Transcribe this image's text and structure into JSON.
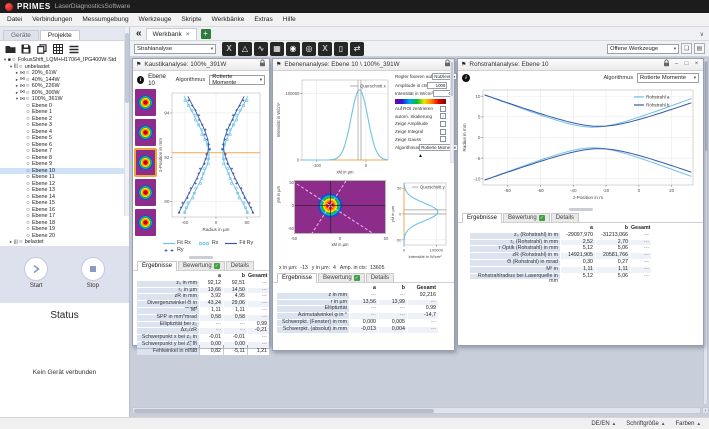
{
  "window": {
    "brand": "PRIMES",
    "app": "LaserDiagnosticsSoftware"
  },
  "menu": {
    "items": [
      "Datei",
      "Verbindungen",
      "Messumgebung",
      "Werkzeuge",
      "Skripte",
      "Werkbänke",
      "Extras",
      "Hilfe"
    ]
  },
  "sidebar": {
    "tabs": [
      "Geräte",
      "Projekte"
    ],
    "active_tab": "Projekte",
    "tree": {
      "root": "FokusShift_LQM+H17064_IPG400W-Std",
      "group": "unbelastet",
      "series": [
        {
          "label": "20%_61W",
          "expanded": false
        },
        {
          "label": "40%_144W",
          "expanded": false
        },
        {
          "label": "60%_226W",
          "expanded": false
        },
        {
          "label": "80%_300W",
          "expanded": false
        },
        {
          "label": "100%_361W",
          "expanded": true
        }
      ],
      "planes": [
        "Ebene 0",
        "Ebene 1",
        "Ebene 2",
        "Ebene 3",
        "Ebene 4",
        "Ebene 5",
        "Ebene 6",
        "Ebene 7",
        "Ebene 8",
        "Ebene 9",
        "Ebene 10",
        "Ebene 11",
        "Ebene 12",
        "Ebene 13",
        "Ebene 14",
        "Ebene 15",
        "Ebene 16",
        "Ebene 17",
        "Ebene 18",
        "Ebene 19",
        "Ebene 20"
      ],
      "selected": "Ebene 10",
      "tail": "belastet"
    },
    "start_label": "Start",
    "stop_label": "Stop",
    "status_title": "Status",
    "status_message": "Kein Gerät verbunden"
  },
  "workspace": {
    "tab_label": "Werkbank",
    "open_tools_label": "Offene Werkzeuge",
    "analysis_select": "Strahlanalyse"
  },
  "result_tabs": [
    "Ergebnisse",
    "Bewertung",
    "Details"
  ],
  "kaustik": {
    "title": "Kaustikanalyse: 100%_391W",
    "level_label": "Ebene 10",
    "algorithm_label": "Algorithmus",
    "algorithm_value": "Rotierte Momente",
    "selected_thumb_index": 2,
    "legend": [
      {
        "label": "Fit Rx",
        "glyph": "line",
        "color": "#6fc2e8"
      },
      {
        "label": "Rx",
        "glyph": "circles",
        "color": "#6fc2e8"
      },
      {
        "label": "Fit Ry",
        "glyph": "line",
        "color": "#3b57a8"
      },
      {
        "label": "Ry",
        "glyph": "plus",
        "color": "#3b57a8"
      }
    ],
    "table": {
      "widths": [
        62,
        23,
        23,
        21
      ],
      "header": [
        "a",
        "b",
        "Gesamt"
      ],
      "rows": [
        [
          "z₀ in mm",
          "92,12",
          "92,51",
          "---"
        ],
        [
          "r₀ in µm",
          "13,66",
          "14,50",
          "---"
        ],
        [
          "zR in mm",
          "3,92",
          "4,95",
          "---"
        ],
        [
          "Divergenzwinkel Θ in mrad",
          "43,24",
          "29,06",
          "---"
        ],
        [
          "M²",
          "1,11",
          "1,11",
          "---"
        ],
        [
          "SPP in mm*mrad",
          "0,58",
          "0,58",
          "---"
        ],
        [
          "Elliptizität bei z₀",
          "---",
          "---",
          "0,99"
        ],
        [
          "Δz₀/zR",
          "---",
          "---",
          "-0,21"
        ],
        [
          "Schwerpunkt x bei z₀ in mm",
          "-0,01",
          "-0,01",
          "---"
        ],
        [
          "Schwerpunkt y bei z₀ in mm",
          "0,00",
          "0,00",
          "---"
        ],
        [
          "Fehlwinkel in mrad",
          "0,82",
          "-5,11",
          "1,21"
        ]
      ]
    }
  },
  "ebenen": {
    "title": "Ebenenanalyse: Ebene 10 \\ 100%_391W",
    "controls": [
      {
        "name": "regler-fixieren-select",
        "label": "Regler fixieren auf",
        "type": "select",
        "value": "Nutzlevel"
      },
      {
        "name": "amplitude-input",
        "label": "Amplitude in cts",
        "type": "input",
        "value": "1005"
      },
      {
        "name": "intensitaet-input",
        "label": "Intensität in W/cm²",
        "type": "input",
        "value": "0"
      },
      {
        "name": "colorscale",
        "label": "",
        "type": "gradient"
      },
      {
        "name": "roi-zentrieren-checkbox",
        "label": "Auf ROI zentrieren",
        "type": "check",
        "checked": false
      },
      {
        "name": "autom-skalierung-checkbox",
        "label": "autom. Skalierung",
        "type": "check",
        "checked": true
      },
      {
        "name": "zeige-amplitude-checkbox",
        "label": "Zeige Amplitude",
        "type": "check",
        "checked": false
      },
      {
        "name": "zeige-integral-checkbox",
        "label": "Zeige Integral",
        "type": "check",
        "checked": false
      },
      {
        "name": "zeige-gauss-checkbox",
        "label": "Zeige Gauss",
        "type": "check",
        "checked": false
      },
      {
        "name": "algorithmus-select",
        "label": "Algorithmus",
        "type": "select",
        "value": "Rotierte Momente"
      }
    ],
    "cursor": {
      "x_label": "x in µm:",
      "x": "-13",
      "y_label": "y in µm:",
      "y": "4",
      "amp_label": "Amp. in cts:",
      "amp": "13605"
    },
    "map": {
      "xlabel": "xM in µm",
      "ylabel": "yM in µm",
      "xticks": [
        "-50",
        "0",
        "50"
      ],
      "yticks": [
        "50",
        "0",
        "-50"
      ]
    },
    "table": {
      "widths": [
        72,
        28,
        28,
        30
      ],
      "header": [
        "a",
        "b",
        "Gesamt"
      ],
      "rows": [
        [
          "z in mm",
          "---",
          "---",
          "92,216"
        ],
        [
          "r in µm",
          "13,56",
          "13,99",
          "---"
        ],
        [
          "Elliptizität",
          "---",
          "---",
          "0,99"
        ],
        [
          "Azimutalwinkel φ in °",
          "---",
          "---",
          "-14,7"
        ],
        [
          "Schwerpkt. (Fenster) in mm",
          "0,000",
          "0,005",
          "---"
        ],
        [
          "Schwerpkt. (absolut) in mm",
          "-0,013",
          "0,004",
          "---"
        ]
      ]
    }
  },
  "rohstrahl": {
    "title": "Rohstrahlanalyse: Ebene 10",
    "algorithm_label": "Algorithmus",
    "algorithm_value": "Rotierte Momente",
    "table": {
      "widths": [
        90,
        34,
        34,
        20
      ],
      "header": [
        "a",
        "b",
        "Gesamt"
      ],
      "rows": [
        [
          "z₀ (Rohstrahl) in m",
          "-29097,970",
          "-31213,066",
          "---"
        ],
        [
          "r₀ (Rohstrahl) in mm",
          "2,52",
          "2,70",
          "---"
        ],
        [
          "r Optik (Rohstrahl) in mm",
          "5,12",
          "5,06",
          "---"
        ],
        [
          "zR (Rohstrahl) in m",
          "14921,905",
          "20581,766",
          "---"
        ],
        [
          "Θ (Rohstrahl) in mrad",
          "0,30",
          "0,27",
          "---"
        ],
        [
          "M² in",
          "1,11",
          "1,11",
          "---"
        ],
        [
          "Rohstrahlradius bei Laserquelle in mm",
          "5,12",
          "5,06",
          "---"
        ]
      ]
    }
  },
  "statusbar": {
    "items": [
      "DE/EN",
      "Schriftgröße",
      "Farben"
    ]
  },
  "colors": {
    "accent_orange": "#f0a84c",
    "light_blue": "#6fc2e8",
    "dark_blue": "#3b57a8",
    "purple": "#8e2c8c",
    "green_check": "#3fa143"
  },
  "chart_data": [
    {
      "id": "caustic",
      "type": "scatter",
      "panel": "Kaustikanalyse",
      "xlabel": "Radius in µm",
      "ylabel": "z-Position in mm",
      "xlim": [
        -85,
        85
      ],
      "ylim": [
        89.3,
        94.9
      ],
      "xticks": [
        -60,
        0,
        60
      ],
      "yticks": [
        90,
        92,
        94
      ],
      "focus_line_z": 92.2,
      "series": [
        {
          "name": "Fit Rx",
          "style": "line",
          "color": "#6fc2e8",
          "fit": {
            "r0_um": 13.66,
            "z0_mm": 92.12,
            "zr_mm": 0.6
          }
        },
        {
          "name": "Rx",
          "style": "circles",
          "color": "#6fc2e8",
          "fit": {
            "r0_um": 13.66,
            "z0_mm": 92.12,
            "zr_mm": 0.6
          }
        },
        {
          "name": "Fit Ry",
          "style": "line",
          "color": "#3b57a8",
          "fit": {
            "r0_um": 14.5,
            "z0_mm": 92.51,
            "zr_mm": 0.62
          }
        },
        {
          "name": "Ry",
          "style": "plus",
          "color": "#3b57a8",
          "fit": {
            "r0_um": 14.5,
            "z0_mm": 92.51,
            "zr_mm": 0.62
          }
        }
      ]
    },
    {
      "id": "qx",
      "type": "line",
      "panel": "Ebenenanalyse",
      "label": "Querschnitt x",
      "xlabel": "xM in µm",
      "ylabel": "Intensität in W/cm²",
      "xlim": [
        -130,
        45
      ],
      "ylim": [
        0,
        120000
      ],
      "xticks": [
        -100,
        0
      ],
      "yticks": [
        0,
        100000
      ],
      "gauss": {
        "center": -13,
        "sigma": 17,
        "amp": 105000
      },
      "color": "#6fc2e8"
    },
    {
      "id": "qy",
      "type": "line",
      "panel": "Ebenenanalyse",
      "label": "Querschnitt y",
      "xlabel": "Intensität in W/cm²",
      "ylabel": "yM in µm",
      "xlim": [
        0,
        130000
      ],
      "ylim": [
        -60,
        60
      ],
      "xticks": [
        0,
        100000
      ],
      "yticks": [
        50,
        0,
        -50
      ],
      "gauss": {
        "center": 4,
        "sigma": 17,
        "amp": 105000
      },
      "color": "#6fc2e8"
    },
    {
      "id": "beammap",
      "type": "heatmap",
      "panel": "Ebenenanalyse",
      "xlabel": "xM in µm",
      "ylabel": "yM in µm",
      "xlim": [
        -60,
        60
      ],
      "ylim": [
        -60,
        60
      ],
      "xticks": [
        -50,
        0,
        50
      ],
      "yticks": [
        50,
        0,
        -50
      ],
      "spot_center_um": [
        -13,
        4
      ]
    },
    {
      "id": "raw",
      "type": "line",
      "panel": "Rohstrahlanalyse",
      "xlabel": "z-Position in m",
      "ylabel": "Radius in mm",
      "xlim": [
        -95,
        33
      ],
      "ylim": [
        -11.5,
        11.5
      ],
      "xticks": [
        -80,
        -60,
        -40,
        -20,
        0,
        20
      ],
      "yticks": [
        10,
        5,
        0,
        -5,
        -10
      ],
      "series": [
        {
          "name": "Rohstrahl a",
          "style": "line",
          "color": "#6fc2e8",
          "fit": {
            "r0_mm": 2.5,
            "z0_m": -28,
            "zr_m": 16.5
          }
        },
        {
          "name": "Rohstrahl b",
          "style": "line",
          "color": "#3b57a8",
          "fit": {
            "r0_mm": 2.7,
            "z0_m": -24,
            "zr_m": 19
          }
        }
      ]
    }
  ]
}
